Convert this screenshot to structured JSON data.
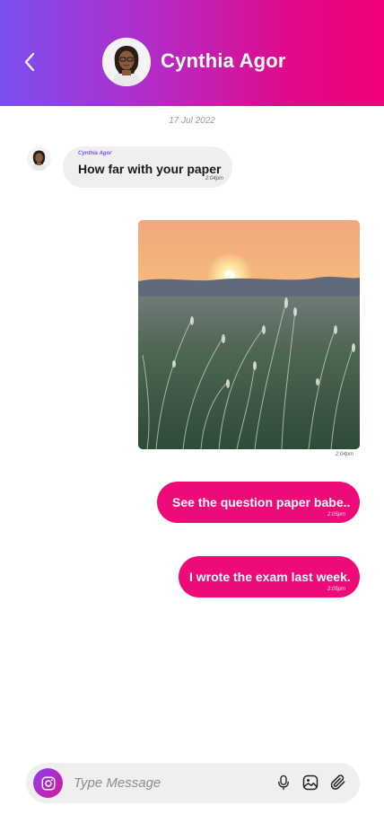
{
  "header": {
    "contact_name": "Cynthia Agor",
    "back_icon": "chevron-left-icon",
    "gradient_start": "#7b4ff0",
    "gradient_end": "#f00078"
  },
  "chat": {
    "date": "17 Jul 2022",
    "messages": [
      {
        "direction": "incoming",
        "sender": "Cynthia Agor",
        "text": "How far with your paper",
        "time": "2:04pm"
      },
      {
        "direction": "outgoing",
        "type": "image",
        "image_icon": "sunset-grass-photo",
        "time": "2:04pm"
      },
      {
        "direction": "outgoing",
        "text": "See the question paper babe..",
        "time": "2:05pm"
      },
      {
        "direction": "outgoing",
        "text": "I wrote the exam last week.",
        "time": "2:05pm"
      }
    ]
  },
  "composer": {
    "placeholder": "Type Message",
    "value": "",
    "camera_icon": "camera-icon",
    "mic_icon": "microphone-icon",
    "gallery_icon": "image-icon",
    "attach_icon": "paperclip-icon"
  },
  "colors": {
    "accent": "#ee0a78",
    "sender_name": "#7b4ff0",
    "incoming_bubble": "#efefef"
  }
}
